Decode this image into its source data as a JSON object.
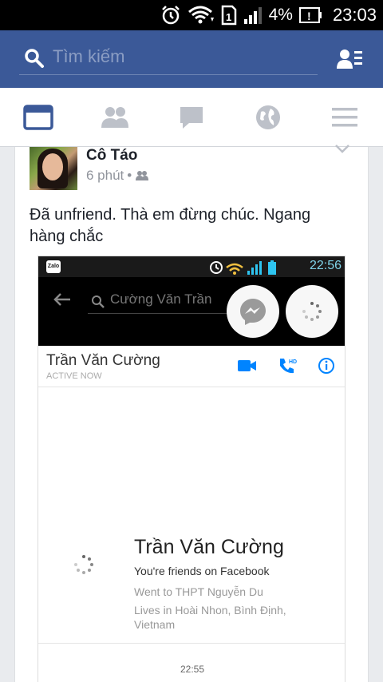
{
  "status_bar": {
    "battery": "4%",
    "time": "23:03"
  },
  "header": {
    "search_placeholder": "Tìm kiếm"
  },
  "nav": {
    "tabs": [
      "news-feed",
      "friend-requests",
      "messages",
      "notifications",
      "menu"
    ]
  },
  "post": {
    "author": "Cô Táo",
    "time": "6 phút",
    "separator": "•",
    "text": "Đã unfriend. Thà em đừng chúc. Ngang hàng chắc"
  },
  "screenshot": {
    "status_time": "22:56",
    "zalo_label": "Zalo",
    "search_text": "Cường Văn Trần",
    "chat_name": "Trần Văn Cường",
    "active_status": "ACTIVE NOW",
    "profile_name": "Trần Văn Cường",
    "friends_text": "You're friends on Facebook",
    "went_to": "Went to THPT Nguyễn Du",
    "lives_in": "Lives in Hoài Nhon, Bình Định, Vietnam",
    "message_time": "22:55"
  },
  "colors": {
    "fb_blue": "#3b5998",
    "messenger_blue": "#0084ff"
  }
}
